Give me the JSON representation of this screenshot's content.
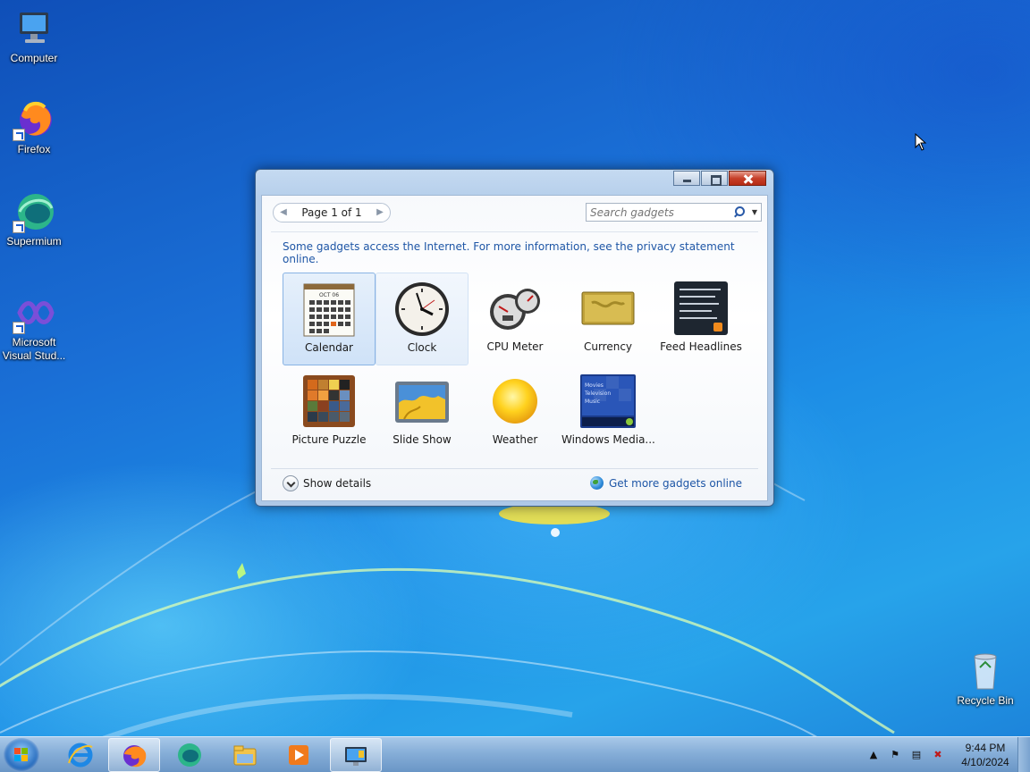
{
  "desktop": {
    "icons": [
      {
        "label": "Computer"
      },
      {
        "label": "Firefox"
      },
      {
        "label": "Supermium"
      },
      {
        "label": "Microsoft Visual Stud..."
      },
      {
        "label": "Recycle Bin"
      }
    ]
  },
  "window": {
    "pager_label": "Page 1 of 1",
    "search_placeholder": "Search gadgets",
    "notice": "Some gadgets access the Internet.  For more information, see the privacy statement online.",
    "gadgets": [
      {
        "name": "Calendar",
        "icon": "calendar-icon"
      },
      {
        "name": "Clock",
        "icon": "clock-icon"
      },
      {
        "name": "CPU Meter",
        "icon": "cpu-meter-icon"
      },
      {
        "name": "Currency",
        "icon": "currency-icon"
      },
      {
        "name": "Feed Headlines",
        "icon": "feed-headlines-icon"
      },
      {
        "name": "Picture Puzzle",
        "icon": "picture-puzzle-icon"
      },
      {
        "name": "Slide Show",
        "icon": "slide-show-icon"
      },
      {
        "name": "Weather",
        "icon": "weather-icon"
      },
      {
        "name": "Windows Media...",
        "icon": "windows-media-icon"
      }
    ],
    "calendar_thumb_month": "OCT 06",
    "media_thumb_lines": [
      "Movies",
      "Television",
      "Music"
    ],
    "show_details_label": "Show details",
    "get_more_label": "Get more gadgets online"
  },
  "taskbar": {
    "items": [
      {
        "icon": "internet-explorer-icon"
      },
      {
        "icon": "firefox-icon"
      },
      {
        "icon": "supermium-icon"
      },
      {
        "icon": "file-explorer-icon"
      },
      {
        "icon": "media-player-icon"
      },
      {
        "icon": "gadgets-icon"
      }
    ],
    "time": "9:44 PM",
    "date": "4/10/2024"
  },
  "colors": {
    "link": "#1e56a6",
    "selection": "#cfe2f8",
    "taskbar": "#86aed8"
  }
}
